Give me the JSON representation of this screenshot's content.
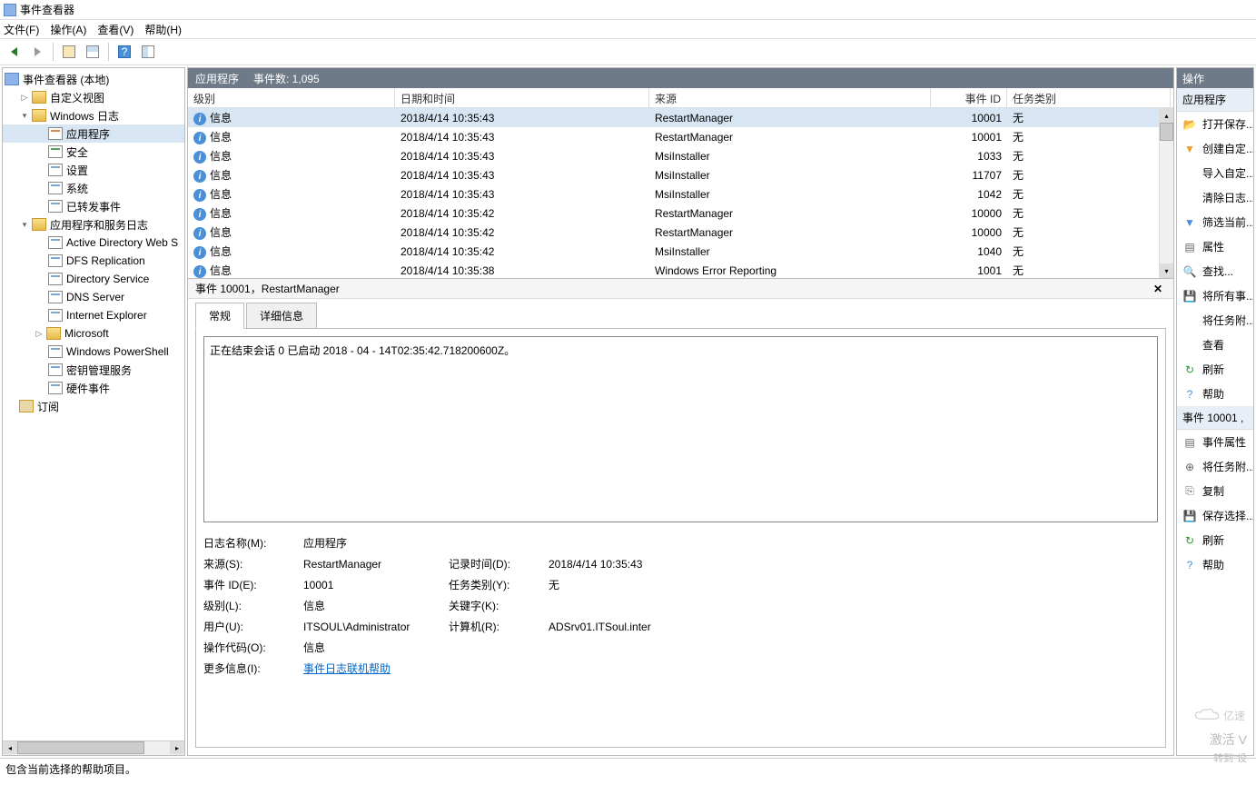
{
  "window": {
    "title": "事件查看器"
  },
  "menubar": {
    "file": "文件(F)",
    "action": "操作(A)",
    "view": "查看(V)",
    "help": "帮助(H)"
  },
  "tree": {
    "root": "事件查看器 (本地)",
    "custom_views": "自定义视图",
    "windows_logs": "Windows 日志",
    "app": "应用程序",
    "security": "安全",
    "setup": "设置",
    "system": "系统",
    "forwarded": "已转发事件",
    "app_service_logs": "应用程序和服务日志",
    "ad_web": "Active Directory Web S",
    "dfs": "DFS Replication",
    "dir_svc": "Directory Service",
    "dns": "DNS Server",
    "ie": "Internet Explorer",
    "ms": "Microsoft",
    "ps": "Windows PowerShell",
    "key_mgmt": "密钥管理服务",
    "hw_events": "硬件事件",
    "subscriptions": "订阅"
  },
  "center": {
    "title": "应用程序",
    "count_label": "事件数: 1,095",
    "columns": {
      "level": "级别",
      "date": "日期和时间",
      "source": "来源",
      "id": "事件 ID",
      "category": "任务类别"
    },
    "rows": [
      {
        "level": "信息",
        "date": "2018/4/14 10:35:43",
        "source": "RestartManager",
        "id": "10001",
        "category": "无",
        "selected": true
      },
      {
        "level": "信息",
        "date": "2018/4/14 10:35:43",
        "source": "RestartManager",
        "id": "10001",
        "category": "无"
      },
      {
        "level": "信息",
        "date": "2018/4/14 10:35:43",
        "source": "MsiInstaller",
        "id": "1033",
        "category": "无"
      },
      {
        "level": "信息",
        "date": "2018/4/14 10:35:43",
        "source": "MsiInstaller",
        "id": "11707",
        "category": "无"
      },
      {
        "level": "信息",
        "date": "2018/4/14 10:35:43",
        "source": "MsiInstaller",
        "id": "1042",
        "category": "无"
      },
      {
        "level": "信息",
        "date": "2018/4/14 10:35:42",
        "source": "RestartManager",
        "id": "10000",
        "category": "无"
      },
      {
        "level": "信息",
        "date": "2018/4/14 10:35:42",
        "source": "RestartManager",
        "id": "10000",
        "category": "无"
      },
      {
        "level": "信息",
        "date": "2018/4/14 10:35:42",
        "source": "MsiInstaller",
        "id": "1040",
        "category": "无"
      },
      {
        "level": "信息",
        "date": "2018/4/14 10:35:38",
        "source": "Windows Error Reporting",
        "id": "1001",
        "category": "无"
      }
    ]
  },
  "detail": {
    "header": "事件 10001，RestartManager",
    "tab_general": "常规",
    "tab_details": "详细信息",
    "message": "正在结束会话 0 已启动   2018  ‎-  ‎04  ‎-  ‎14T02:35:42.718200600Z。",
    "labels": {
      "log_name": "日志名称(M):",
      "source": "来源(S):",
      "event_id": "事件 ID(E):",
      "level": "级别(L):",
      "user": "用户(U):",
      "opcode": "操作代码(O):",
      "more_info": "更多信息(I):",
      "logged": "记录时间(D):",
      "task_cat": "任务类别(Y):",
      "keywords": "关键字(K):",
      "computer": "计算机(R):"
    },
    "values": {
      "log_name": "应用程序",
      "source": "RestartManager",
      "event_id": "10001",
      "level": "信息",
      "user": "ITSOUL\\Administrator",
      "opcode": "信息",
      "more_info": "事件日志联机帮助",
      "logged": "2018/4/14 10:35:43",
      "task_cat": "无",
      "keywords": "",
      "computer": "ADSrv01.ITSoul.inter"
    }
  },
  "actions": {
    "header": "操作",
    "section1": "应用程序",
    "items1": [
      {
        "icon": "open",
        "label": "打开保存..."
      },
      {
        "icon": "filter",
        "label": "创建自定..."
      },
      {
        "icon": "blank",
        "label": "导入自定..."
      },
      {
        "icon": "blank",
        "label": "清除日志..."
      },
      {
        "icon": "funnel",
        "label": "筛选当前..."
      },
      {
        "icon": "props",
        "label": "属性"
      },
      {
        "icon": "find",
        "label": "查找..."
      },
      {
        "icon": "save",
        "label": "将所有事..."
      },
      {
        "icon": "blank",
        "label": "将任务附..."
      },
      {
        "icon": "blank",
        "label": "查看"
      },
      {
        "icon": "refresh",
        "label": "刷新"
      },
      {
        "icon": "help",
        "label": "帮助"
      }
    ],
    "section2": "事件 10001 ,",
    "items2": [
      {
        "icon": "props",
        "label": "事件属性"
      },
      {
        "icon": "task",
        "label": "将任务附..."
      },
      {
        "icon": "copy",
        "label": "复制"
      },
      {
        "icon": "save",
        "label": "保存选择..."
      },
      {
        "icon": "refresh",
        "label": "刷新"
      },
      {
        "icon": "help",
        "label": "帮助"
      }
    ]
  },
  "statusbar": {
    "text": "包含当前选择的帮助项目。"
  },
  "watermark": {
    "line1": "激活 V",
    "line2": "转到\"设",
    "brand": "亿速"
  }
}
